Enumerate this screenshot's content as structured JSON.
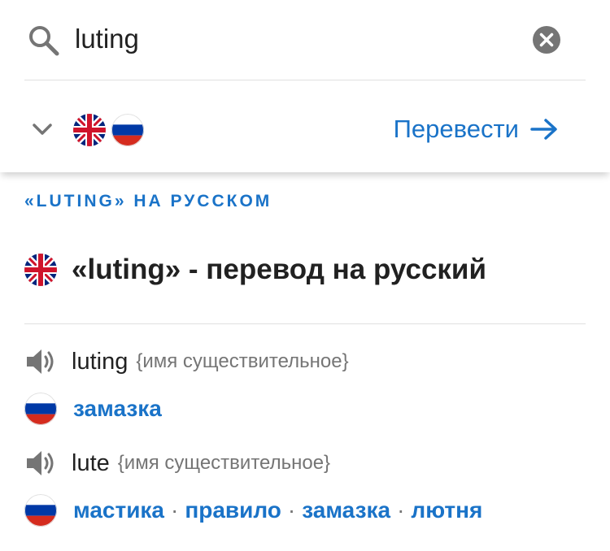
{
  "search": {
    "query": "luting"
  },
  "translate_bar": {
    "source_lang_icon": "uk-flag-icon",
    "target_lang_icon": "ru-flag-icon",
    "translate_label": "Перевести"
  },
  "section_heading": "«LUTING» НА РУССКОМ",
  "page_title": "«luting» - перевод на русский",
  "entries": [
    {
      "headword": "luting",
      "pos": "{имя существительное}",
      "translations": [
        "замазка"
      ]
    },
    {
      "headword": "lute",
      "pos": "{имя существительное}",
      "translations": [
        "мастика",
        "правило",
        "замазка",
        "лютня"
      ]
    }
  ],
  "separator": "·",
  "colors": {
    "accent": "#1a73c8",
    "text": "#212121",
    "muted": "#757575",
    "divider": "#e0e0e0"
  }
}
